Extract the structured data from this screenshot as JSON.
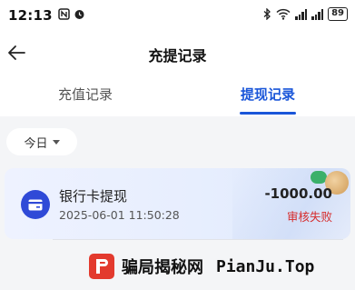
{
  "status_bar": {
    "time": "12:13",
    "battery": "89"
  },
  "nav": {
    "title": "充提记录"
  },
  "tabs": [
    {
      "label": "充值记录",
      "active": false
    },
    {
      "label": "提现记录",
      "active": true
    }
  ],
  "filter": {
    "date_label": "今日"
  },
  "records": [
    {
      "title": "银行卡提现",
      "time": "2025-06-01 11:50:28",
      "amount": "-1000.00",
      "status": "审核失败",
      "icon": "bank-card-icon"
    }
  ],
  "watermark": {
    "cn": "骗局揭秘网",
    "en": "PianJu.Top"
  },
  "colors": {
    "accent": "#1a56d9",
    "status_fail": "#d62c2c",
    "card_icon_bg": "#2f4ad7",
    "logo_red": "#e33a2e"
  }
}
